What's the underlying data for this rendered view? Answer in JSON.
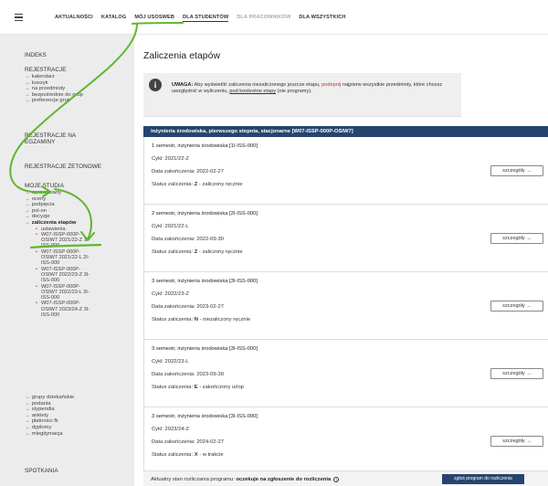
{
  "nav": {
    "items": [
      {
        "label": "AKTUALNOŚCI",
        "state": "normal"
      },
      {
        "label": "KATALOG",
        "state": "normal"
      },
      {
        "label": "MÓJ USOSWEB",
        "state": "normal"
      },
      {
        "label": "DLA STUDENTÓW",
        "state": "active"
      },
      {
        "label": "DLA PRACOWNIKÓW",
        "state": "muted"
      },
      {
        "label": "DLA WSZYSTKICH",
        "state": "normal"
      }
    ]
  },
  "sidebar": {
    "indeks": "INDEKS",
    "rejestracje": "REJESTRACJE",
    "rejestracje_items": [
      "kalendarz",
      "koszyk",
      "na przedmioty",
      "bezpośrednie do grup",
      "preferencje grup"
    ],
    "rejestracje_na_egzaminy_1": "REJESTRACJE NA",
    "rejestracje_na_egzaminy_2": "EGZAMINY",
    "rejestracje_zetonowe": "REJESTRACJE ŻETONOWE",
    "moje_studia": "MOJE STUDIA",
    "moje_studia_items": [
      "sprawdziany",
      "oceny",
      "podpięcia",
      "pol-on",
      "decyzje"
    ],
    "zaliczenia_etapow": "zaliczenia etapów",
    "sub_items": [
      "ustawienia",
      "W07-ISSP-000P-",
      "OSIW7 2021/22-Z 1I-",
      "ISS-000",
      "W07-ISSP-000P-",
      "OSIW7 2021/22-L 2I-",
      "ISS-000",
      "W07-ISSP-000P-",
      "OSIW7 2022/23-Z 3I-",
      "ISS-000",
      "W07-ISSP-000P-",
      "OSIW7 2022/23-L 3I-",
      "ISS-000",
      "W07-ISSP-000P-",
      "OSIW7 2023/24-Z 3I-",
      "ISS-000"
    ],
    "more_items": [
      "grupy dziekańskie",
      "podania",
      "stypendia",
      "ankiety",
      "płatności fk",
      "dyplomy",
      "mlegitymacja"
    ],
    "spotkania": "SPOTKANIA"
  },
  "main": {
    "title": "Zaliczenia etapów",
    "info": {
      "bold": "UWAGA:",
      "text1": " Aby wyświetlić zaliczenia niezaliczonego jeszcze etapu, ",
      "link1": "podepnij",
      "text2": " najpierw wszystkie przedmioty, które chcesz uwzględnić w wyliczeniu, ",
      "link2": "pod konkretne etapy",
      "text3": " (nie programy)."
    },
    "program": "inżynieria środowiska, pierwszego stopnia, stacjonarne [W07-ISSP-000P-OSIW7]",
    "labels": {
      "cykl": "Cykl:",
      "data": "Data zakończenia:",
      "status": "Status zaliczenia:"
    },
    "details_label": "szczegóły →",
    "stages": [
      {
        "title": "1 semestr, inżynieria środowiska [1I-ISS-000]",
        "cykl": "2021/22-Z",
        "data": "2022-02-27",
        "status_code": "Z",
        "status_text": " - zaliczony ręcznie"
      },
      {
        "title": "2 semestr, inżynieria środowiska [2I-ISS-000]",
        "cykl": "2021/22-L",
        "data": "2022-09-30",
        "status_code": "Z",
        "status_text": " - zaliczony ręcznie"
      },
      {
        "title": "3 semestr, inżynieria środowiska [3I-ISS-000]",
        "cykl": "2022/23-Z",
        "data": "2023-02-27",
        "status_code": "N",
        "status_text": " - niezaliczony ręcznie"
      },
      {
        "title": "3 semestr, inżynieria środowiska [3I-ISS-000]",
        "cykl": "2022/23-L",
        "data": "2023-09-30",
        "status_code": "E",
        "status_text": " - zakończony urlop"
      },
      {
        "title": "3 semestr, inżynieria środowiska [3I-ISS-000]",
        "cykl": "2023/24-Z",
        "data": "2024-02-27",
        "status_code": "X",
        "status_text": " - w trakcie"
      }
    ],
    "footer": {
      "text": "Aktualny stan rozliczania programu: ",
      "bold": "oczekuje na zgłoszenie do rozliczenia",
      "info_icon": "i",
      "button": "zgłoś program do rozliczenia"
    }
  },
  "colors": {
    "annotation": "#5db82f",
    "primary": "#26456e",
    "accent_red": "#c0392b"
  },
  "icons": {
    "menu": "hamburger-icon",
    "info": "info-icon"
  },
  "info_icon_glyph": "i"
}
